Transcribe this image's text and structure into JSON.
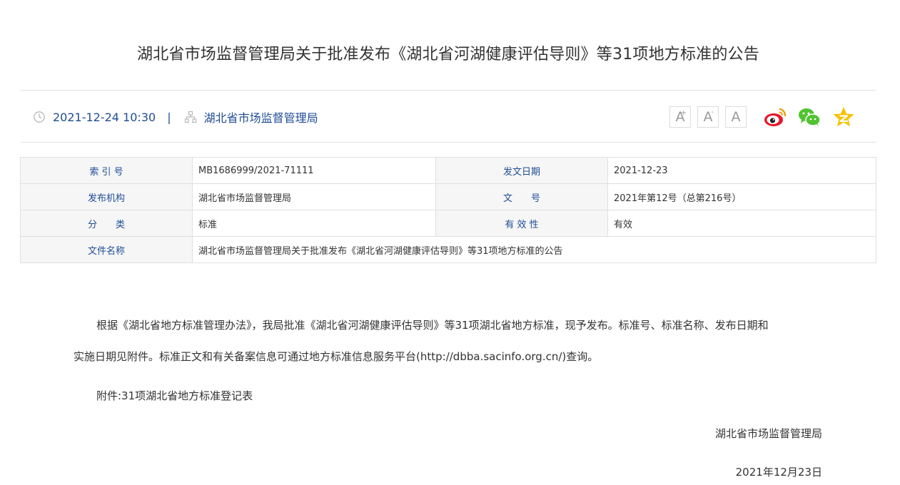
{
  "title": "湖北省市场监督管理局关于批准发布《湖北省河湖健康评估导则》等31项地方标准的公告",
  "meta": {
    "datetime": "2021-12-24 10:30",
    "separator": "|",
    "source": "湖北省市场监督管理局",
    "clock_icon": "clock-icon",
    "org_icon": "org-icon"
  },
  "tools": {
    "font_large": "A",
    "font_medium": "A",
    "font_small": "A",
    "font_large_mark": "+",
    "font_medium_mark": "-",
    "share_icons": [
      "weibo-icon",
      "wechat-icon",
      "qzone-icon"
    ]
  },
  "info": {
    "index_label": "索 引 号",
    "index_value": "MB1686999/2021-71111",
    "date_label": "发文日期",
    "date_value": "2021-12-23",
    "org_label": "发布机构",
    "org_value": "湖北省市场监督管理局",
    "doc_label": "文　　号",
    "doc_value": "2021年第12号（总第216号）",
    "cat_label": "分　　类",
    "cat_value": "标准",
    "valid_label": "有 效 性",
    "valid_value": "有效",
    "name_label": "文件名称",
    "name_value": "湖北省市场监督管理局关于批准发布《湖北省河湖健康评估导则》等31项地方标准的公告"
  },
  "body": {
    "para1_line1": "根据《湖北省地方标准管理办法》，我局批准《湖北省河湖健康评估导则》等31项湖北省地方标准，现予发布。标准号、标准名称、发布日期和",
    "para1_line2": "实施日期见附件。标准正文和有关备案信息可通过地方标准信息服务平台(http://dbba.sacinfo.org.cn/)查询。",
    "attachment": "附件:31项湖北省地方标准登记表",
    "signature": "湖北省市场监督管理局",
    "sign_date": "2021年12月23日"
  },
  "colors": {
    "link_blue": "#1e4c96",
    "weibo": "#e6162d",
    "wechat": "#51c332",
    "qzone": "#f6c200"
  }
}
